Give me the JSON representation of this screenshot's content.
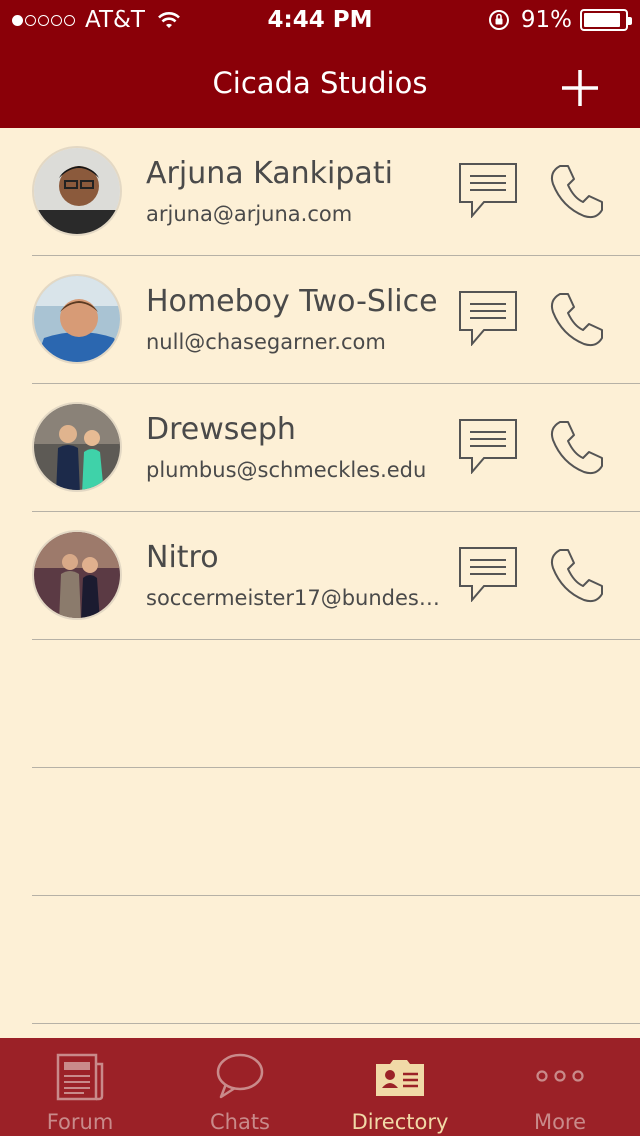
{
  "status": {
    "carrier": "AT&T",
    "time": "4:44 PM",
    "battery": "91%",
    "battery_level": 0.91
  },
  "header": {
    "title": "Cicada Studios"
  },
  "contacts": [
    {
      "name": "Arjuna Kankipati",
      "email": "arjuna@arjuna.com"
    },
    {
      "name": "Homeboy Two-Slice",
      "email": "null@chasegarner.com"
    },
    {
      "name": "Drewseph",
      "email": "plumbus@schmeckles.edu"
    },
    {
      "name": "Nitro",
      "email": "soccermeister17@bundes…"
    }
  ],
  "tabs": [
    {
      "label": "Forum",
      "icon": "newspaper-icon",
      "active": false
    },
    {
      "label": "Chats",
      "icon": "chat-bubble-icon",
      "active": false
    },
    {
      "label": "Directory",
      "icon": "contact-card-icon",
      "active": true
    },
    {
      "label": "More",
      "icon": "more-dots-icon",
      "active": false
    }
  ],
  "colors": {
    "header_bg": "#8a0008",
    "list_bg": "#fdf0d6",
    "tabbar_bg": "#9b2127",
    "tab_active": "#f1d9a7",
    "tab_inactive": "#c98a8a"
  }
}
